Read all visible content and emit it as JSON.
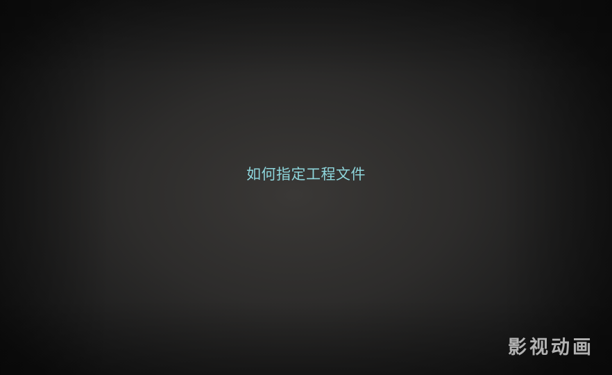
{
  "slide": {
    "title": "如何指定工程文件"
  },
  "watermark": {
    "text": "影视动画"
  },
  "colors": {
    "title_text": "#8ed6dc",
    "background": "#2c2b2a",
    "watermark_text": "#cfcfcf"
  }
}
